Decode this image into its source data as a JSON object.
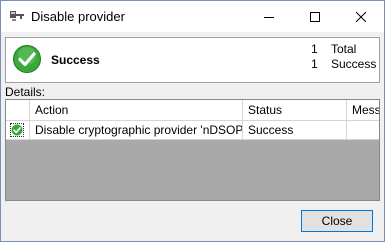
{
  "window": {
    "title": "Disable provider"
  },
  "summary": {
    "status": "Success",
    "total_count": "1",
    "total_label": "Total",
    "success_count": "1",
    "success_label": "Success"
  },
  "details": {
    "label": "Details:",
    "columns": [
      "Action",
      "Status",
      "Message"
    ],
    "rows": [
      {
        "action": "Disable cryptographic provider 'nDSOP'",
        "status": "Success",
        "message": ""
      }
    ]
  },
  "footer": {
    "close_label": "Close"
  },
  "colors": {
    "accent": "#0078d7",
    "success_green": "#3aa83a"
  },
  "icons": {
    "title": "key-lock-icon",
    "summary": "success-check-icon",
    "row": "success-check-icon"
  }
}
